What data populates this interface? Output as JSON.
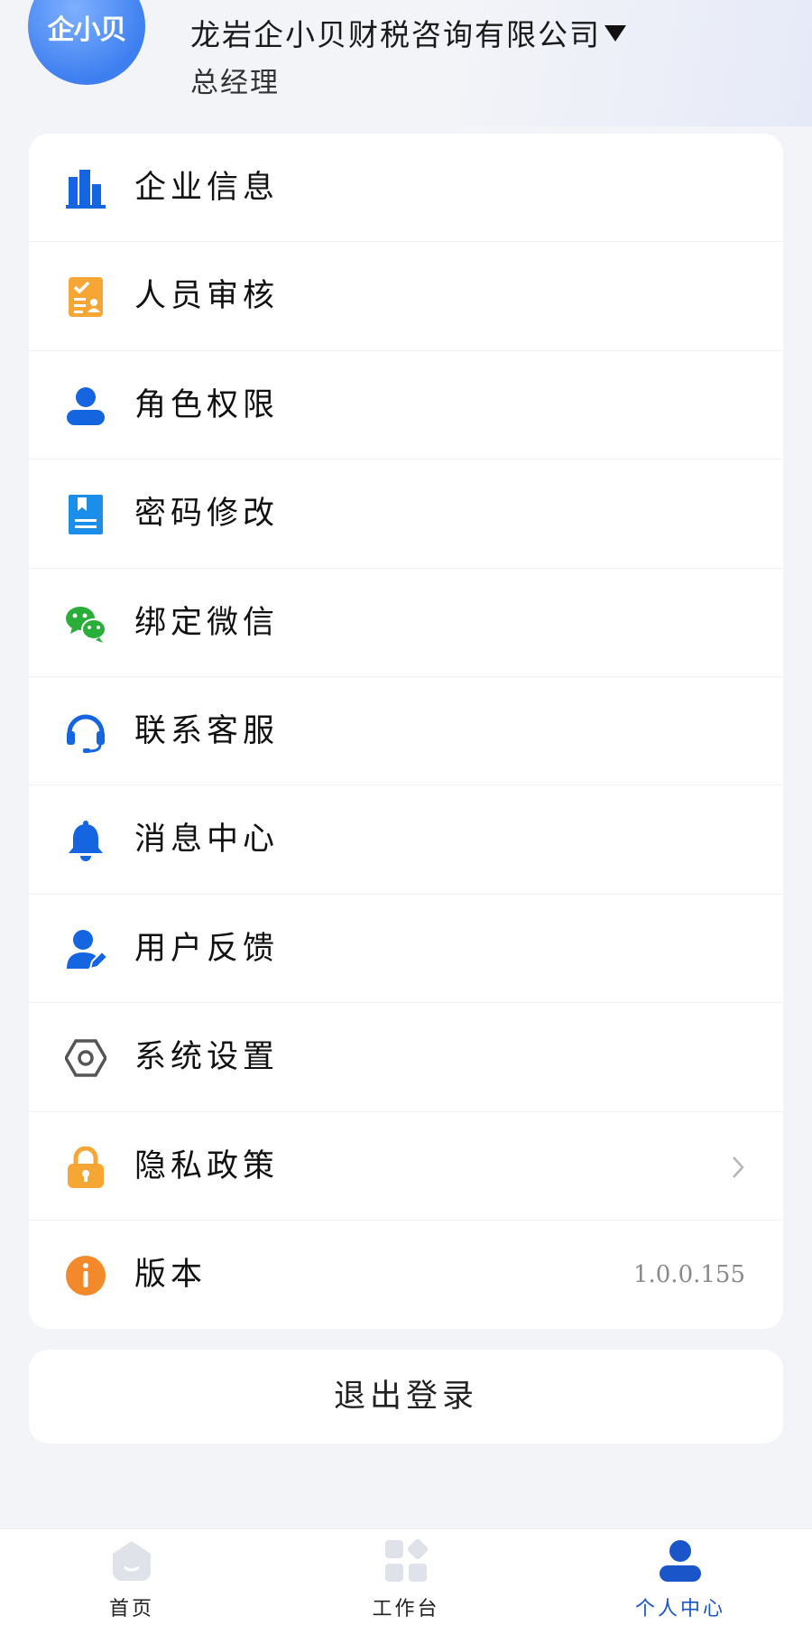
{
  "header": {
    "avatar_logo": "企小贝",
    "company": "龙岩企小贝财税咨询有限公司",
    "role": "总经理"
  },
  "menu": [
    {
      "label": "企业信息",
      "icon": "building-icon",
      "color": "#1565e0"
    },
    {
      "label": "人员审核",
      "icon": "checklist-icon",
      "color": "#f5a635"
    },
    {
      "label": "角色权限",
      "icon": "user-icon",
      "color": "#1565e0"
    },
    {
      "label": "密码修改",
      "icon": "document-icon",
      "color": "#1a8ee8"
    },
    {
      "label": "绑定微信",
      "icon": "wechat-icon",
      "color": "#2aae3a"
    },
    {
      "label": "联系客服",
      "icon": "headset-icon",
      "color": "#1565e0"
    },
    {
      "label": "消息中心",
      "icon": "bell-icon",
      "color": "#1565e0"
    },
    {
      "label": "用户反馈",
      "icon": "user-edit-icon",
      "color": "#1565e0"
    },
    {
      "label": "系统设置",
      "icon": "settings-hex-icon",
      "color": "#555555"
    },
    {
      "label": "隐私政策",
      "icon": "lock-icon",
      "color": "#f5a635"
    },
    {
      "label": "版本",
      "icon": "info-icon",
      "color": "#f28a2c",
      "value": "1.0.0.155"
    }
  ],
  "logout_label": "退出登录",
  "tabs": [
    {
      "label": "首页",
      "icon": "home-icon"
    },
    {
      "label": "工作台",
      "icon": "grid-icon"
    },
    {
      "label": "个人中心",
      "icon": "user-tab-icon",
      "active": true
    }
  ],
  "colors": {
    "accent": "#1a56c9",
    "background": "#f3f4f8"
  }
}
